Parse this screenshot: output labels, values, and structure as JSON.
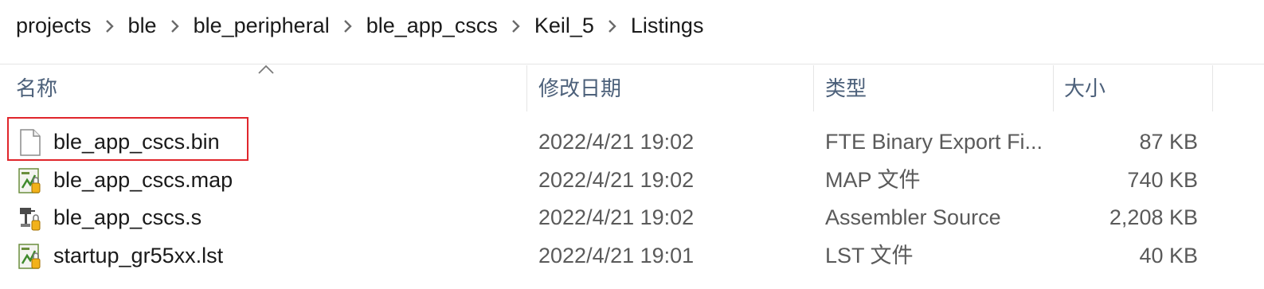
{
  "breadcrumb": {
    "items": [
      "projects",
      "ble",
      "ble_peripheral",
      "ble_app_cscs",
      "Keil_5",
      "Listings"
    ],
    "separator_icon": "chevron-right-icon"
  },
  "columns": {
    "name": "名称",
    "date": "修改日期",
    "type": "类型",
    "size": "大小",
    "sort_icon": "sort-ascending-icon"
  },
  "files": [
    {
      "name": "ble_app_cscs.bin",
      "date": "2022/4/21 19:02",
      "type": "FTE Binary Export Fi...",
      "size": "87 KB",
      "icon": "blank-file-icon",
      "selected_highlight": true
    },
    {
      "name": "ble_app_cscs.map",
      "date": "2022/4/21 19:02",
      "type": "MAP 文件",
      "size": "740 KB",
      "icon": "keil-file-icon"
    },
    {
      "name": "ble_app_cscs.s",
      "date": "2022/4/21 19:02",
      "type": "Assembler Source",
      "size": "2,208 KB",
      "icon": "assembler-file-icon"
    },
    {
      "name": "startup_gr55xx.lst",
      "date": "2022/4/21 19:01",
      "type": "LST 文件",
      "size": "40 KB",
      "icon": "keil-file-icon"
    }
  ],
  "colors": {
    "highlight_border": "#e0262c",
    "header_text": "#4c607a"
  }
}
